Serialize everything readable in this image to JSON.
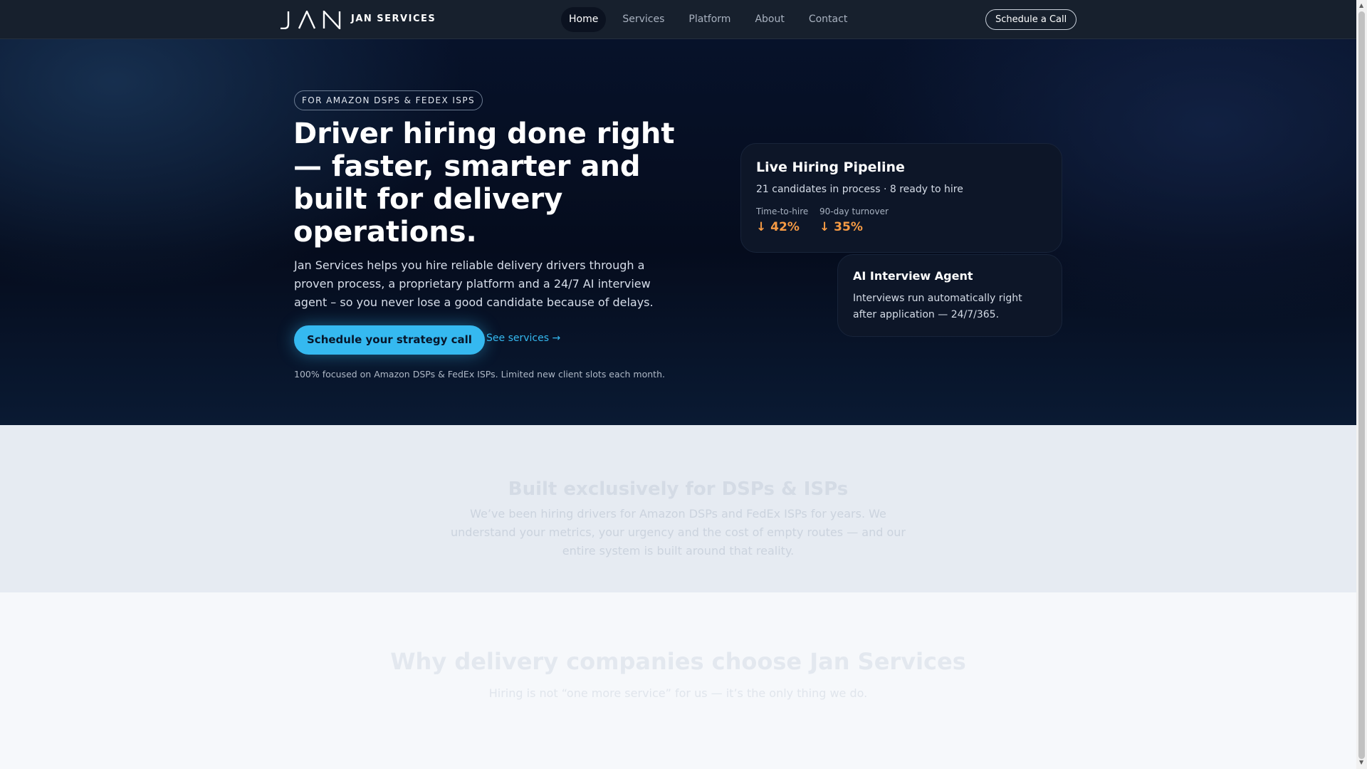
{
  "nav": {
    "brand": "JAN SERVICES",
    "logo_name": "jan-logo-mark",
    "links": [
      {
        "label": "Home",
        "active": true
      },
      {
        "label": "Services",
        "active": false
      },
      {
        "label": "Platform",
        "active": false
      },
      {
        "label": "About",
        "active": false
      },
      {
        "label": "Contact",
        "active": false
      }
    ],
    "cta": "Schedule a Call"
  },
  "hero": {
    "badge": "FOR AMAZON DSPS & FEDEX ISPS",
    "title": "Driver hiring done right — faster, smarter and built for delivery operations.",
    "description": "Jan Services helps you hire reliable delivery drivers through a proven process, a proprietary platform and a 24/7 AI interview agent – so you never lose a good candidate because of delays.",
    "primary_cta": "Schedule your strategy call",
    "secondary_cta": "See services →",
    "note": "100% focused on Amazon DSPs & FedEx ISPs. Limited new client slots each month."
  },
  "pipeline_card": {
    "title": "Live Hiring Pipeline",
    "subtitle": "21 candidates in process · 8 ready to hire",
    "stats": [
      {
        "label": "Time-to-hire",
        "value": "↓ 42%"
      },
      {
        "label": "90-day turnover",
        "value": "↓ 35%"
      }
    ]
  },
  "agent_card": {
    "title": "AI Interview Agent",
    "description": "Interviews run automatically right after application — 24/7/365."
  },
  "built_section": {
    "title": "Built exclusively for DSPs & ISPs",
    "description": "We’ve been hiring drivers for Amazon DSPs and FedEx ISPs for years. We understand your metrics, your urgency and the cost of empty routes — and our entire system is built around that reality."
  },
  "why_section": {
    "title": "Why delivery companies choose Jan Services",
    "subtitle": "Hiring is not “one more service” for us — it’s the only thing we do."
  },
  "colors": {
    "accent": "#35b9f0",
    "stat_orange": "#f59a44",
    "nav_bg": "#17202d",
    "hero_bg": "#050c1d"
  }
}
